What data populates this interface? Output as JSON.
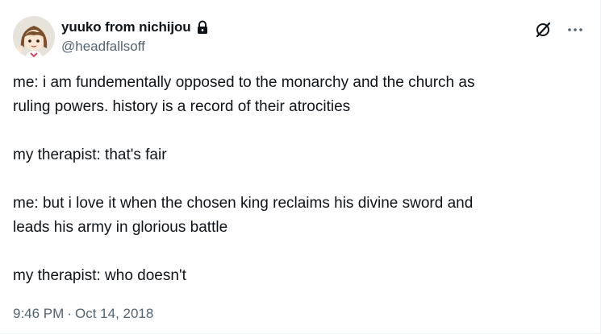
{
  "author": {
    "display_name": "yuuko from nichijou",
    "handle": "@headfallsoff",
    "avatar_icon": "anime-character-avatar",
    "protected_icon": "lock-icon"
  },
  "actions": {
    "grok_icon": "grok-slash-icon",
    "more_icon": "more-horizontal-icon"
  },
  "tweet": {
    "lines": [
      "me: i am fundementally opposed to the monarchy and the church as",
      "ruling powers. history is a record of their atrocities",
      "my therapist: that's fair",
      "me: but i love it when the chosen king reclaims his divine sword and",
      "leads his army in glorious battle",
      "my therapist: who doesn't"
    ]
  },
  "meta": {
    "time": "9:46 PM",
    "separator": "·",
    "date": "Oct 14, 2018"
  },
  "colors": {
    "text_primary": "#0f1419",
    "text_secondary": "#536471",
    "border": "#eff3f4"
  }
}
